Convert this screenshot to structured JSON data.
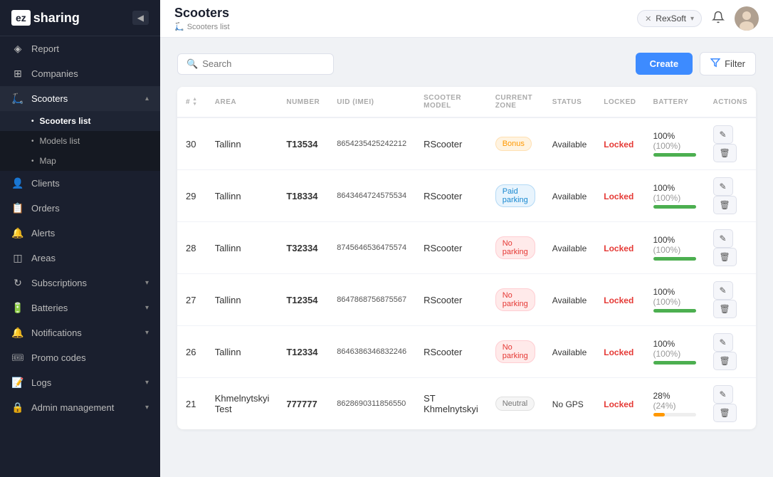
{
  "sidebar": {
    "logo": "ez",
    "logo_suffix": "sharing",
    "items": [
      {
        "id": "report",
        "label": "Report",
        "icon": "📊",
        "active": false
      },
      {
        "id": "companies",
        "label": "Companies",
        "icon": "🏢",
        "active": false
      },
      {
        "id": "scooters",
        "label": "Scooters",
        "icon": "🛴",
        "active": true,
        "expanded": true
      },
      {
        "id": "clients",
        "label": "Clients",
        "icon": "👤",
        "active": false
      },
      {
        "id": "orders",
        "label": "Orders",
        "icon": "📋",
        "active": false
      },
      {
        "id": "alerts",
        "label": "Alerts",
        "icon": "🔔",
        "active": false
      },
      {
        "id": "areas",
        "label": "Areas",
        "icon": "🗺️",
        "active": false
      },
      {
        "id": "subscriptions",
        "label": "Subscriptions",
        "icon": "🔁",
        "active": false,
        "arrow": "▾"
      },
      {
        "id": "batteries",
        "label": "Batteries",
        "icon": "🔋",
        "active": false,
        "arrow": "▾"
      },
      {
        "id": "notifications",
        "label": "Notifications",
        "icon": "🔔",
        "active": false,
        "arrow": "▾"
      },
      {
        "id": "promo-codes",
        "label": "Promo codes",
        "icon": "🎟️",
        "active": false
      },
      {
        "id": "logs",
        "label": "Logs",
        "icon": "📝",
        "active": false,
        "arrow": "▾"
      },
      {
        "id": "admin",
        "label": "Admin management",
        "icon": "🔒",
        "active": false,
        "arrow": "▾"
      }
    ],
    "sub_items": [
      {
        "label": "Scooters list",
        "active": true
      },
      {
        "label": "Models list",
        "active": false
      },
      {
        "label": "Map",
        "active": false
      }
    ]
  },
  "topbar": {
    "title": "Scooters",
    "breadcrumb_label": "Scooters list",
    "org": "RexSoft",
    "notifications_label": "notifications icon",
    "avatar_label": "user avatar"
  },
  "toolbar": {
    "search_placeholder": "Search",
    "create_label": "Create",
    "filter_label": "Filter"
  },
  "table": {
    "columns": [
      "#",
      "AREA",
      "NUMBER",
      "UID (IMEI)",
      "SCOOTER MODEL",
      "CURRENT ZONE",
      "STATUS",
      "LOCKED",
      "BATTERY",
      "ACTIONS"
    ],
    "rows": [
      {
        "num": "30",
        "area": "Tallinn",
        "number": "T13534",
        "uid": "8654235425242212",
        "model": "RScooter",
        "zone": "Bonus",
        "zone_type": "bonus",
        "status": "Available",
        "locked": "Locked",
        "battery_pct": "100%",
        "battery_pct2": "(100%)",
        "battery_fill": 100,
        "battery_low": false
      },
      {
        "num": "29",
        "area": "Tallinn",
        "number": "T18334",
        "uid": "8643464724575534",
        "model": "RScooter",
        "zone": "Paid parking",
        "zone_type": "paid",
        "status": "Available",
        "locked": "Locked",
        "battery_pct": "100%",
        "battery_pct2": "(100%)",
        "battery_fill": 100,
        "battery_low": false
      },
      {
        "num": "28",
        "area": "Tallinn",
        "number": "T32334",
        "uid": "8745646536475574",
        "model": "RScooter",
        "zone": "No parking",
        "zone_type": "noparking",
        "status": "Available",
        "locked": "Locked",
        "battery_pct": "100%",
        "battery_pct2": "(100%)",
        "battery_fill": 100,
        "battery_low": false
      },
      {
        "num": "27",
        "area": "Tallinn",
        "number": "T12354",
        "uid": "8647868756875567",
        "model": "RScooter",
        "zone": "No parking",
        "zone_type": "noparking",
        "status": "Available",
        "locked": "Locked",
        "battery_pct": "100%",
        "battery_pct2": "(100%)",
        "battery_fill": 100,
        "battery_low": false
      },
      {
        "num": "26",
        "area": "Tallinn",
        "number": "T12334",
        "uid": "8646386346832246",
        "model": "RScooter",
        "zone": "No parking",
        "zone_type": "noparking",
        "status": "Available",
        "locked": "Locked",
        "battery_pct": "100%",
        "battery_pct2": "(100%)",
        "battery_fill": 100,
        "battery_low": false
      },
      {
        "num": "21",
        "area": "Khmelnytskyi Test",
        "number": "777777",
        "uid": "8628690311856550",
        "model": "ST Khmelnytskyi",
        "zone": "Neutral",
        "zone_type": "neutral",
        "status": "No GPS",
        "locked": "Locked",
        "battery_pct": "28%",
        "battery_pct2": "(24%)",
        "battery_fill": 28,
        "battery_low": true
      }
    ]
  }
}
